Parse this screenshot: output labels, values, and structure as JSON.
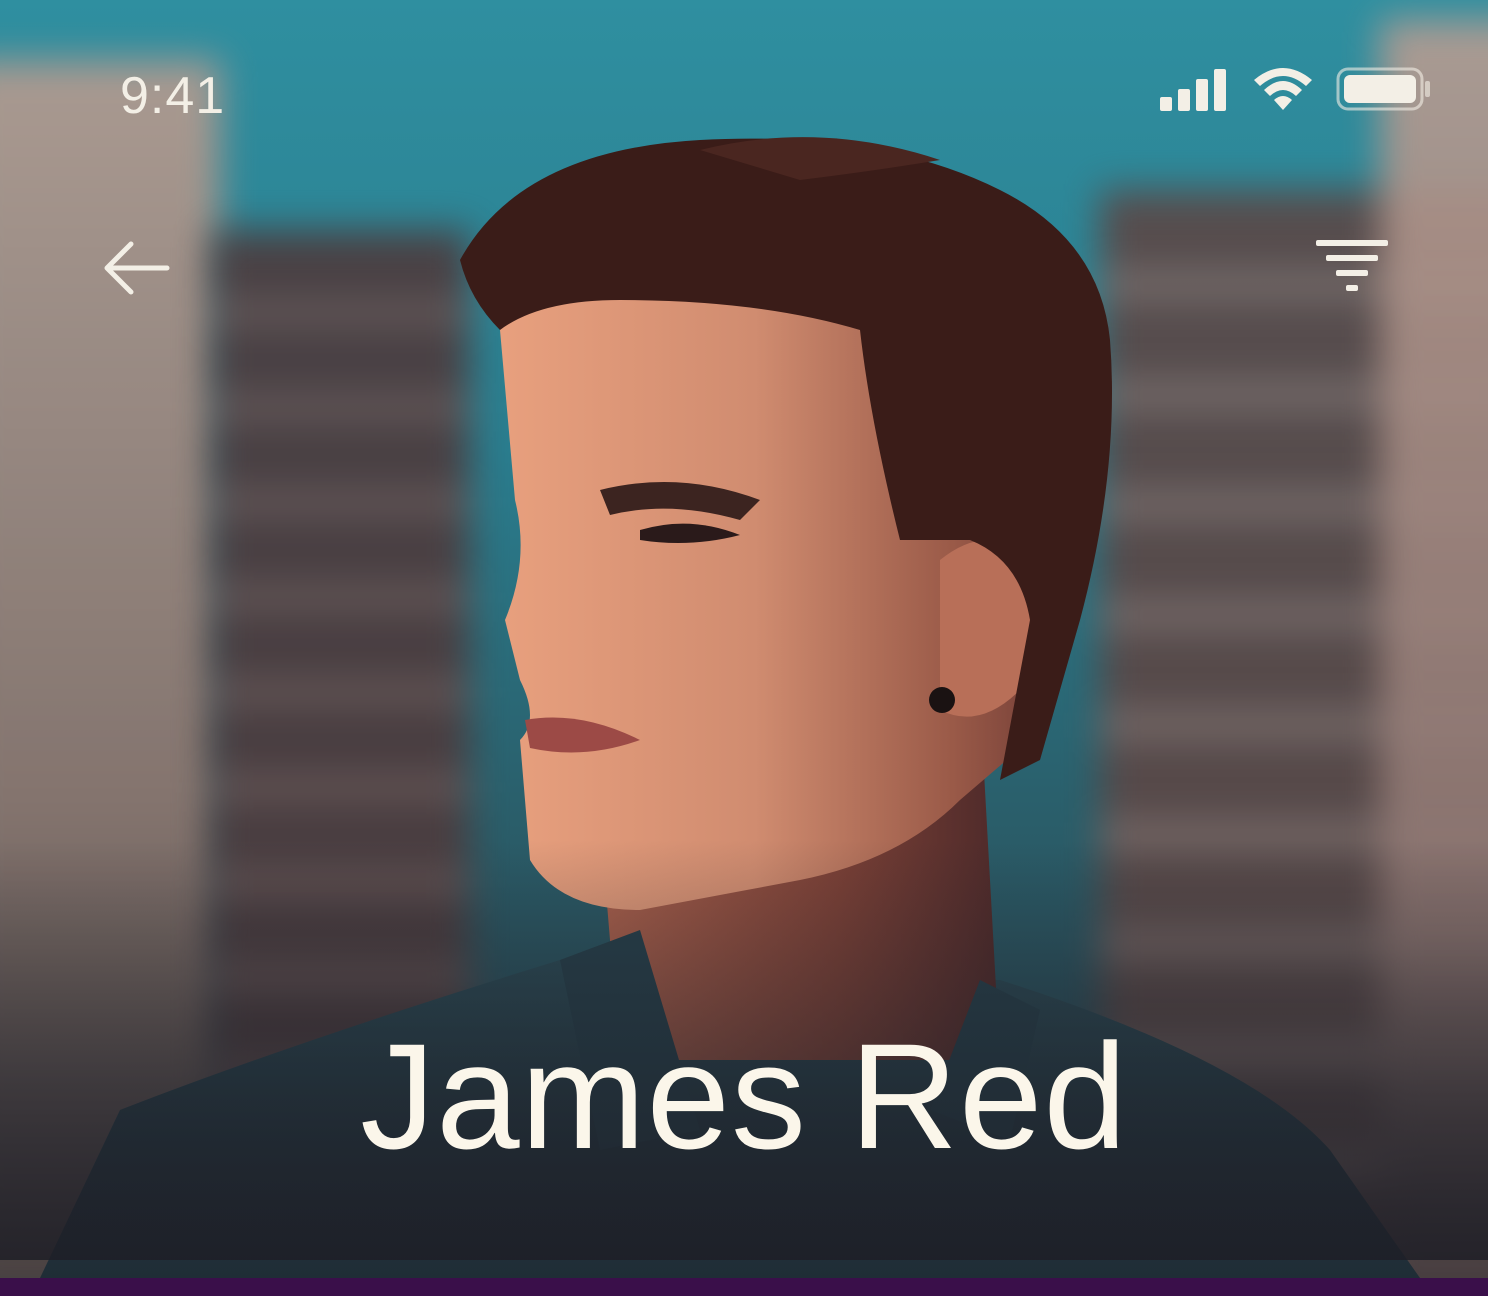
{
  "status_bar": {
    "time": "9:41",
    "icons": [
      "cellular-signal-icon",
      "wifi-icon",
      "battery-icon"
    ]
  },
  "nav": {
    "back_icon": "arrow-left-icon",
    "filter_icon": "filter-icon"
  },
  "profile": {
    "name": "James Red",
    "photo": "profile-photo"
  },
  "colors": {
    "text": "#fbf6ea",
    "bottom_bar": "#3a0f4a",
    "sky": "#2f8fa0"
  }
}
